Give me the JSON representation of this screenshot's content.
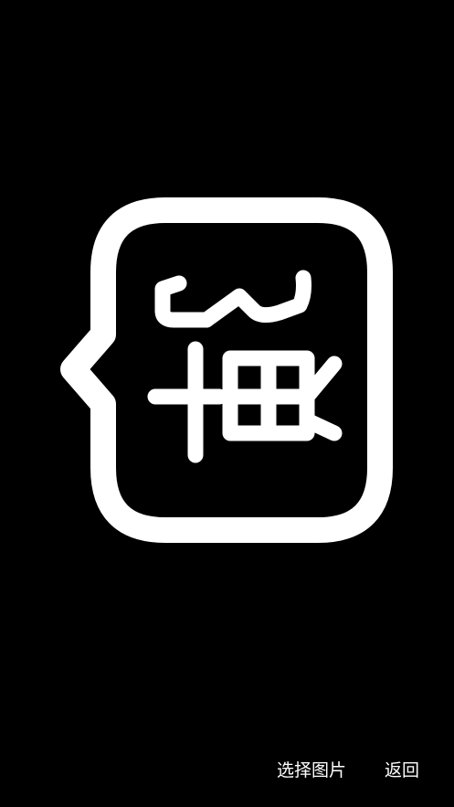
{
  "preview": {
    "image_name": "speech-bubble-logo-icon",
    "background_color": "#000000",
    "foreground_color": "#ffffff"
  },
  "bottom_bar": {
    "choose_image_label": "选择图片",
    "back_label": "返回"
  }
}
